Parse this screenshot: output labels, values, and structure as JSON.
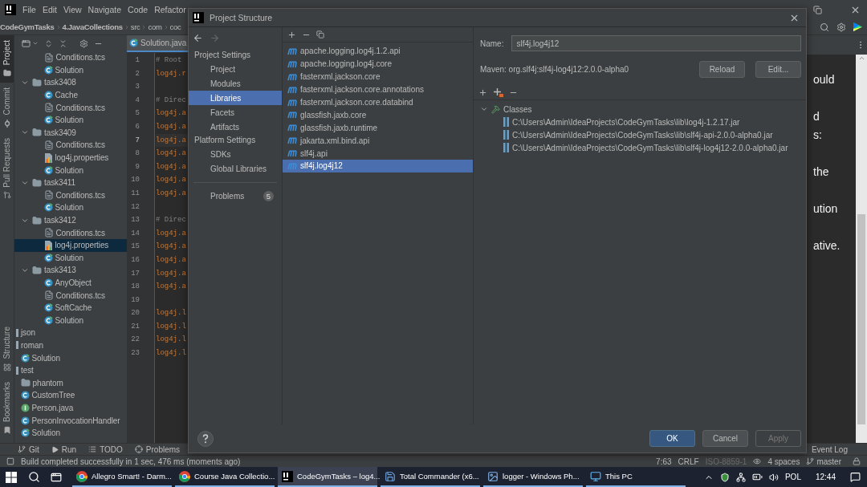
{
  "menu_bar": {
    "items": [
      "File",
      "Edit",
      "View",
      "Navigate",
      "Code",
      "Refactor"
    ]
  },
  "breadcrumbs": [
    {
      "label": "CodeGymTasks",
      "kind": "project"
    },
    {
      "label": "4.JavaCollections",
      "kind": "module"
    },
    {
      "label": "src",
      "kind": "folder"
    },
    {
      "label": "com",
      "kind": "package"
    },
    {
      "label": "coc",
      "kind": "package"
    }
  ],
  "tool_windows": {
    "top": [
      {
        "label": "Project",
        "kind": "project",
        "selected": true
      },
      {
        "label": "Commit",
        "kind": "commit",
        "selected": false
      },
      {
        "label": "Pull Requests",
        "kind": "pullrequests",
        "selected": false
      }
    ],
    "bottom": [
      {
        "label": "Structure",
        "kind": "structure",
        "selected": false
      },
      {
        "label": "Bookmarks",
        "kind": "bookmarks",
        "selected": false
      }
    ]
  },
  "project_tree": [
    {
      "kind": "offscreen",
      "children": [
        {
          "kind": "offscreen",
          "children": [
            {
              "kind": "offscreen",
              "children": [
                {
                  "label": "Conditions.tcs",
                  "kind": "tcs",
                  "selected": false
                },
                {
                  "label": "Solution",
                  "kind": "main",
                  "selected": false
                }
              ]
            },
            {
              "label": "task3408",
              "kind": "folder",
              "expanded": true,
              "selected": false,
              "children": [
                {
                  "label": "Cache",
                  "kind": "class",
                  "selected": false
                },
                {
                  "label": "Conditions.tcs",
                  "kind": "tcs",
                  "selected": false
                },
                {
                  "label": "Solution",
                  "kind": "main",
                  "selected": false
                }
              ]
            },
            {
              "label": "task3409",
              "kind": "folder",
              "expanded": true,
              "selected": false,
              "children": [
                {
                  "label": "Conditions.tcs",
                  "kind": "tcs",
                  "selected": false
                },
                {
                  "label": "log4j.properties",
                  "kind": "properties",
                  "selected": false
                },
                {
                  "label": "Solution",
                  "kind": "main",
                  "selected": false
                }
              ]
            },
            {
              "label": "task3411",
              "kind": "folder",
              "expanded": true,
              "selected": false,
              "children": [
                {
                  "label": "Conditions.tcs",
                  "kind": "tcs",
                  "selected": false
                },
                {
                  "label": "Solution",
                  "kind": "main",
                  "selected": false
                }
              ]
            },
            {
              "label": "task3412",
              "kind": "folder",
              "expanded": true,
              "selected": false,
              "children": [
                {
                  "label": "Conditions.tcs",
                  "kind": "tcs",
                  "selected": false
                },
                {
                  "label": "log4j.properties",
                  "kind": "properties",
                  "selected": true
                },
                {
                  "label": "Solution",
                  "kind": "main",
                  "selected": false
                }
              ]
            },
            {
              "label": "task3413",
              "kind": "folder",
              "expanded": true,
              "selected": false,
              "children": [
                {
                  "label": "AnyObject",
                  "kind": "class",
                  "selected": false
                },
                {
                  "label": "Conditions.tcs",
                  "kind": "tcs",
                  "selected": false
                },
                {
                  "label": "SoftCache",
                  "kind": "main",
                  "selected": false
                },
                {
                  "label": "Solution",
                  "kind": "main",
                  "selected": false
                }
              ]
            }
          ]
        }
      ]
    },
    {
      "label": "json",
      "kind": "package",
      "selected": false
    },
    {
      "label": "roman",
      "kind": "package",
      "selected": false,
      "children": [
        {
          "label": "Solution",
          "kind": "main",
          "selected": false
        }
      ]
    },
    {
      "label": "test",
      "kind": "package",
      "selected": false,
      "children": [
        {
          "label": "phantom",
          "kind": "folder",
          "selected": false
        },
        {
          "label": "CustomTree",
          "kind": "class",
          "selected": false
        },
        {
          "label": "Person.java",
          "kind": "interface",
          "selected": false
        },
        {
          "label": "PersonInvocationHandler",
          "kind": "class",
          "selected": false
        },
        {
          "label": "Solution",
          "kind": "main",
          "selected": false
        }
      ]
    }
  ],
  "editor": {
    "tab": {
      "label": "Solution.java",
      "selected": true
    },
    "lines": [
      {
        "number": "1",
        "kind": "comment",
        "text": "# Root",
        "current": false
      },
      {
        "number": "2",
        "kind": "code",
        "text": "log4j.r",
        "current": false
      },
      {
        "number": "3",
        "kind": "blank",
        "current": false
      },
      {
        "number": "4",
        "kind": "comment",
        "text": "# Direc",
        "current": false
      },
      {
        "number": "5",
        "kind": "code",
        "text": "log4j.a",
        "current": false
      },
      {
        "number": "6",
        "kind": "code",
        "text": "log4j.a",
        "current": false
      },
      {
        "number": "7",
        "kind": "code",
        "text": "log4j.a",
        "current": true
      },
      {
        "number": "8",
        "kind": "code",
        "text": "log4j.a",
        "current": false
      },
      {
        "number": "9",
        "kind": "code",
        "text": "log4j.a",
        "current": false
      },
      {
        "number": "10",
        "kind": "code",
        "text": "log4j.a",
        "current": false
      },
      {
        "number": "11",
        "kind": "code",
        "text": "log4j.a",
        "current": false
      },
      {
        "number": "12",
        "kind": "blank",
        "current": false
      },
      {
        "number": "13",
        "kind": "comment",
        "text": "# Direc",
        "current": false
      },
      {
        "number": "14",
        "kind": "code",
        "text": "log4j.a",
        "current": false
      },
      {
        "number": "15",
        "kind": "code",
        "text": "log4j.a",
        "current": false
      },
      {
        "number": "16",
        "kind": "code",
        "text": "log4j.a",
        "current": false
      },
      {
        "number": "17",
        "kind": "code",
        "text": "log4j.a",
        "current": false
      },
      {
        "number": "18",
        "kind": "code",
        "text": "log4j.a",
        "current": false
      },
      {
        "number": "19",
        "kind": "blank",
        "current": false
      },
      {
        "number": "20",
        "kind": "code",
        "text": "log4j.l",
        "current": false
      },
      {
        "number": "21",
        "kind": "code",
        "text": "log4j.l",
        "current": false
      },
      {
        "number": "22",
        "kind": "code",
        "text": "log4j.l",
        "current": false
      },
      {
        "number": "23",
        "kind": "code",
        "text": "log4j.l",
        "current": false
      }
    ]
  },
  "side_page": {
    "paragraphs": [
      [
        "ould"
      ],
      [
        "d",
        "s:"
      ],
      [
        "the"
      ],
      [
        "ution"
      ],
      [
        "ative."
      ]
    ]
  },
  "dialog": {
    "title": "Project Structure",
    "nav_arrows": [
      {
        "kind": "back",
        "disabled": false
      },
      {
        "kind": "forward",
        "disabled": true
      }
    ],
    "nav_sections": [
      {
        "heading": "Project Settings",
        "items": [
          {
            "label": "Project",
            "selected": false
          },
          {
            "label": "Modules",
            "selected": false
          },
          {
            "label": "Libraries",
            "selected": true
          },
          {
            "label": "Facets",
            "selected": false
          },
          {
            "label": "Artifacts",
            "selected": false
          }
        ]
      },
      {
        "heading": "Platform Settings",
        "items": [
          {
            "label": "SDKs",
            "selected": false
          },
          {
            "label": "Global Libraries",
            "selected": false
          }
        ]
      }
    ],
    "problems": {
      "label": "Problems",
      "count": "5"
    },
    "libraries": [
      {
        "label": "apache.logging.log4j.1.2.api",
        "selected": false
      },
      {
        "label": "apache.logging.log4j.core",
        "selected": false
      },
      {
        "label": "fasterxml.jackson.core",
        "selected": false
      },
      {
        "label": "fasterxml.jackson.core.annotations",
        "selected": false
      },
      {
        "label": "fasterxml.jackson.core.databind",
        "selected": false
      },
      {
        "label": "glassfish.jaxb.core",
        "selected": false
      },
      {
        "label": "glassfish.jaxb.runtime",
        "selected": false
      },
      {
        "label": "jakarta.xml.bind.api",
        "selected": false
      },
      {
        "label": "slf4j.api",
        "selected": false
      },
      {
        "label": "slf4j.log4j12",
        "selected": true
      }
    ],
    "details": {
      "name_label": "Name:",
      "name_value": "slf4j.log4j12",
      "maven": "Maven: org.slf4j:slf4j-log4j12:2.0.0-alpha0",
      "buttons": [
        "Reload",
        "Edit..."
      ],
      "roots": [
        {
          "label": "Classes",
          "expanded": true,
          "children": [
            {
              "label": "C:\\Users\\Admin\\IdeaProjects\\CodeGymTasks\\lib\\log4j-1.2.17.jar"
            },
            {
              "label": "C:\\Users\\Admin\\IdeaProjects\\CodeGymTasks\\lib\\slf4j-api-2.0.0-alpha0.jar"
            },
            {
              "label": "C:\\Users\\Admin\\IdeaProjects\\CodeGymTasks\\lib\\slf4j-log4j12-2.0.0-alpha0.jar"
            }
          ]
        }
      ]
    },
    "buttons": [
      {
        "label": "OK",
        "primary": true,
        "disabled": false
      },
      {
        "label": "Cancel",
        "primary": false,
        "disabled": false
      },
      {
        "label": "Apply",
        "primary": false,
        "disabled": true
      }
    ]
  },
  "tool_tabs": [
    {
      "label": "Git",
      "kind": "git"
    },
    {
      "label": "Run",
      "kind": "run"
    },
    {
      "label": "TODO",
      "kind": "todo"
    },
    {
      "label": "Problems",
      "kind": "problems"
    }
  ],
  "event_log": "Event Log",
  "status_bar": {
    "message": "Build completed successfully in 1 sec, 476 ms (moments ago)",
    "position": "7:63",
    "line_separator": "CRLF",
    "encoding": "ISO-8859-1",
    "indent": "4 spaces",
    "branch": "master"
  },
  "taskbar": {
    "apps": [
      {
        "label": "Allegro Smart! - Darm...",
        "kind": "chrome",
        "selected": false
      },
      {
        "label": "Course Java Collectio...",
        "kind": "chrome",
        "selected": false
      },
      {
        "label": "CodeGymTasks – log4...",
        "kind": "intellij",
        "selected": true
      },
      {
        "label": "Total Commander (x6...",
        "kind": "totalcmd",
        "selected": false
      },
      {
        "label": "logger - Windows Ph...",
        "kind": "photos",
        "selected": false
      },
      {
        "label": "This PC",
        "kind": "explorer",
        "selected": false
      }
    ],
    "language": "POL",
    "time": "12:44"
  }
}
